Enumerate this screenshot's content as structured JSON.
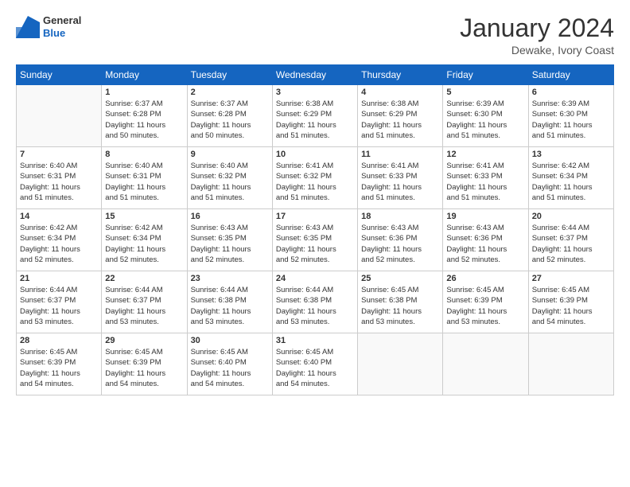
{
  "header": {
    "logo": {
      "general": "General",
      "blue": "Blue"
    },
    "title": "January 2024",
    "location": "Dewake, Ivory Coast"
  },
  "calendar": {
    "days_of_week": [
      "Sunday",
      "Monday",
      "Tuesday",
      "Wednesday",
      "Thursday",
      "Friday",
      "Saturday"
    ],
    "weeks": [
      [
        {
          "day": "",
          "sunrise": "",
          "sunset": "",
          "daylight": "",
          "empty": true
        },
        {
          "day": "1",
          "sunrise": "Sunrise: 6:37 AM",
          "sunset": "Sunset: 6:28 PM",
          "daylight": "Daylight: 11 hours and 50 minutes."
        },
        {
          "day": "2",
          "sunrise": "Sunrise: 6:37 AM",
          "sunset": "Sunset: 6:28 PM",
          "daylight": "Daylight: 11 hours and 50 minutes."
        },
        {
          "day": "3",
          "sunrise": "Sunrise: 6:38 AM",
          "sunset": "Sunset: 6:29 PM",
          "daylight": "Daylight: 11 hours and 51 minutes."
        },
        {
          "day": "4",
          "sunrise": "Sunrise: 6:38 AM",
          "sunset": "Sunset: 6:29 PM",
          "daylight": "Daylight: 11 hours and 51 minutes."
        },
        {
          "day": "5",
          "sunrise": "Sunrise: 6:39 AM",
          "sunset": "Sunset: 6:30 PM",
          "daylight": "Daylight: 11 hours and 51 minutes."
        },
        {
          "day": "6",
          "sunrise": "Sunrise: 6:39 AM",
          "sunset": "Sunset: 6:30 PM",
          "daylight": "Daylight: 11 hours and 51 minutes."
        }
      ],
      [
        {
          "day": "7",
          "sunrise": "Sunrise: 6:40 AM",
          "sunset": "Sunset: 6:31 PM",
          "daylight": "Daylight: 11 hours and 51 minutes."
        },
        {
          "day": "8",
          "sunrise": "Sunrise: 6:40 AM",
          "sunset": "Sunset: 6:31 PM",
          "daylight": "Daylight: 11 hours and 51 minutes."
        },
        {
          "day": "9",
          "sunrise": "Sunrise: 6:40 AM",
          "sunset": "Sunset: 6:32 PM",
          "daylight": "Daylight: 11 hours and 51 minutes."
        },
        {
          "day": "10",
          "sunrise": "Sunrise: 6:41 AM",
          "sunset": "Sunset: 6:32 PM",
          "daylight": "Daylight: 11 hours and 51 minutes."
        },
        {
          "day": "11",
          "sunrise": "Sunrise: 6:41 AM",
          "sunset": "Sunset: 6:33 PM",
          "daylight": "Daylight: 11 hours and 51 minutes."
        },
        {
          "day": "12",
          "sunrise": "Sunrise: 6:41 AM",
          "sunset": "Sunset: 6:33 PM",
          "daylight": "Daylight: 11 hours and 51 minutes."
        },
        {
          "day": "13",
          "sunrise": "Sunrise: 6:42 AM",
          "sunset": "Sunset: 6:34 PM",
          "daylight": "Daylight: 11 hours and 51 minutes."
        }
      ],
      [
        {
          "day": "14",
          "sunrise": "Sunrise: 6:42 AM",
          "sunset": "Sunset: 6:34 PM",
          "daylight": "Daylight: 11 hours and 52 minutes."
        },
        {
          "day": "15",
          "sunrise": "Sunrise: 6:42 AM",
          "sunset": "Sunset: 6:34 PM",
          "daylight": "Daylight: 11 hours and 52 minutes."
        },
        {
          "day": "16",
          "sunrise": "Sunrise: 6:43 AM",
          "sunset": "Sunset: 6:35 PM",
          "daylight": "Daylight: 11 hours and 52 minutes."
        },
        {
          "day": "17",
          "sunrise": "Sunrise: 6:43 AM",
          "sunset": "Sunset: 6:35 PM",
          "daylight": "Daylight: 11 hours and 52 minutes."
        },
        {
          "day": "18",
          "sunrise": "Sunrise: 6:43 AM",
          "sunset": "Sunset: 6:36 PM",
          "daylight": "Daylight: 11 hours and 52 minutes."
        },
        {
          "day": "19",
          "sunrise": "Sunrise: 6:43 AM",
          "sunset": "Sunset: 6:36 PM",
          "daylight": "Daylight: 11 hours and 52 minutes."
        },
        {
          "day": "20",
          "sunrise": "Sunrise: 6:44 AM",
          "sunset": "Sunset: 6:37 PM",
          "daylight": "Daylight: 11 hours and 52 minutes."
        }
      ],
      [
        {
          "day": "21",
          "sunrise": "Sunrise: 6:44 AM",
          "sunset": "Sunset: 6:37 PM",
          "daylight": "Daylight: 11 hours and 53 minutes."
        },
        {
          "day": "22",
          "sunrise": "Sunrise: 6:44 AM",
          "sunset": "Sunset: 6:37 PM",
          "daylight": "Daylight: 11 hours and 53 minutes."
        },
        {
          "day": "23",
          "sunrise": "Sunrise: 6:44 AM",
          "sunset": "Sunset: 6:38 PM",
          "daylight": "Daylight: 11 hours and 53 minutes."
        },
        {
          "day": "24",
          "sunrise": "Sunrise: 6:44 AM",
          "sunset": "Sunset: 6:38 PM",
          "daylight": "Daylight: 11 hours and 53 minutes."
        },
        {
          "day": "25",
          "sunrise": "Sunrise: 6:45 AM",
          "sunset": "Sunset: 6:38 PM",
          "daylight": "Daylight: 11 hours and 53 minutes."
        },
        {
          "day": "26",
          "sunrise": "Sunrise: 6:45 AM",
          "sunset": "Sunset: 6:39 PM",
          "daylight": "Daylight: 11 hours and 53 minutes."
        },
        {
          "day": "27",
          "sunrise": "Sunrise: 6:45 AM",
          "sunset": "Sunset: 6:39 PM",
          "daylight": "Daylight: 11 hours and 54 minutes."
        }
      ],
      [
        {
          "day": "28",
          "sunrise": "Sunrise: 6:45 AM",
          "sunset": "Sunset: 6:39 PM",
          "daylight": "Daylight: 11 hours and 54 minutes."
        },
        {
          "day": "29",
          "sunrise": "Sunrise: 6:45 AM",
          "sunset": "Sunset: 6:39 PM",
          "daylight": "Daylight: 11 hours and 54 minutes."
        },
        {
          "day": "30",
          "sunrise": "Sunrise: 6:45 AM",
          "sunset": "Sunset: 6:40 PM",
          "daylight": "Daylight: 11 hours and 54 minutes."
        },
        {
          "day": "31",
          "sunrise": "Sunrise: 6:45 AM",
          "sunset": "Sunset: 6:40 PM",
          "daylight": "Daylight: 11 hours and 54 minutes."
        },
        {
          "day": "",
          "sunrise": "",
          "sunset": "",
          "daylight": "",
          "empty": true
        },
        {
          "day": "",
          "sunrise": "",
          "sunset": "",
          "daylight": "",
          "empty": true
        },
        {
          "day": "",
          "sunrise": "",
          "sunset": "",
          "daylight": "",
          "empty": true
        }
      ]
    ]
  }
}
